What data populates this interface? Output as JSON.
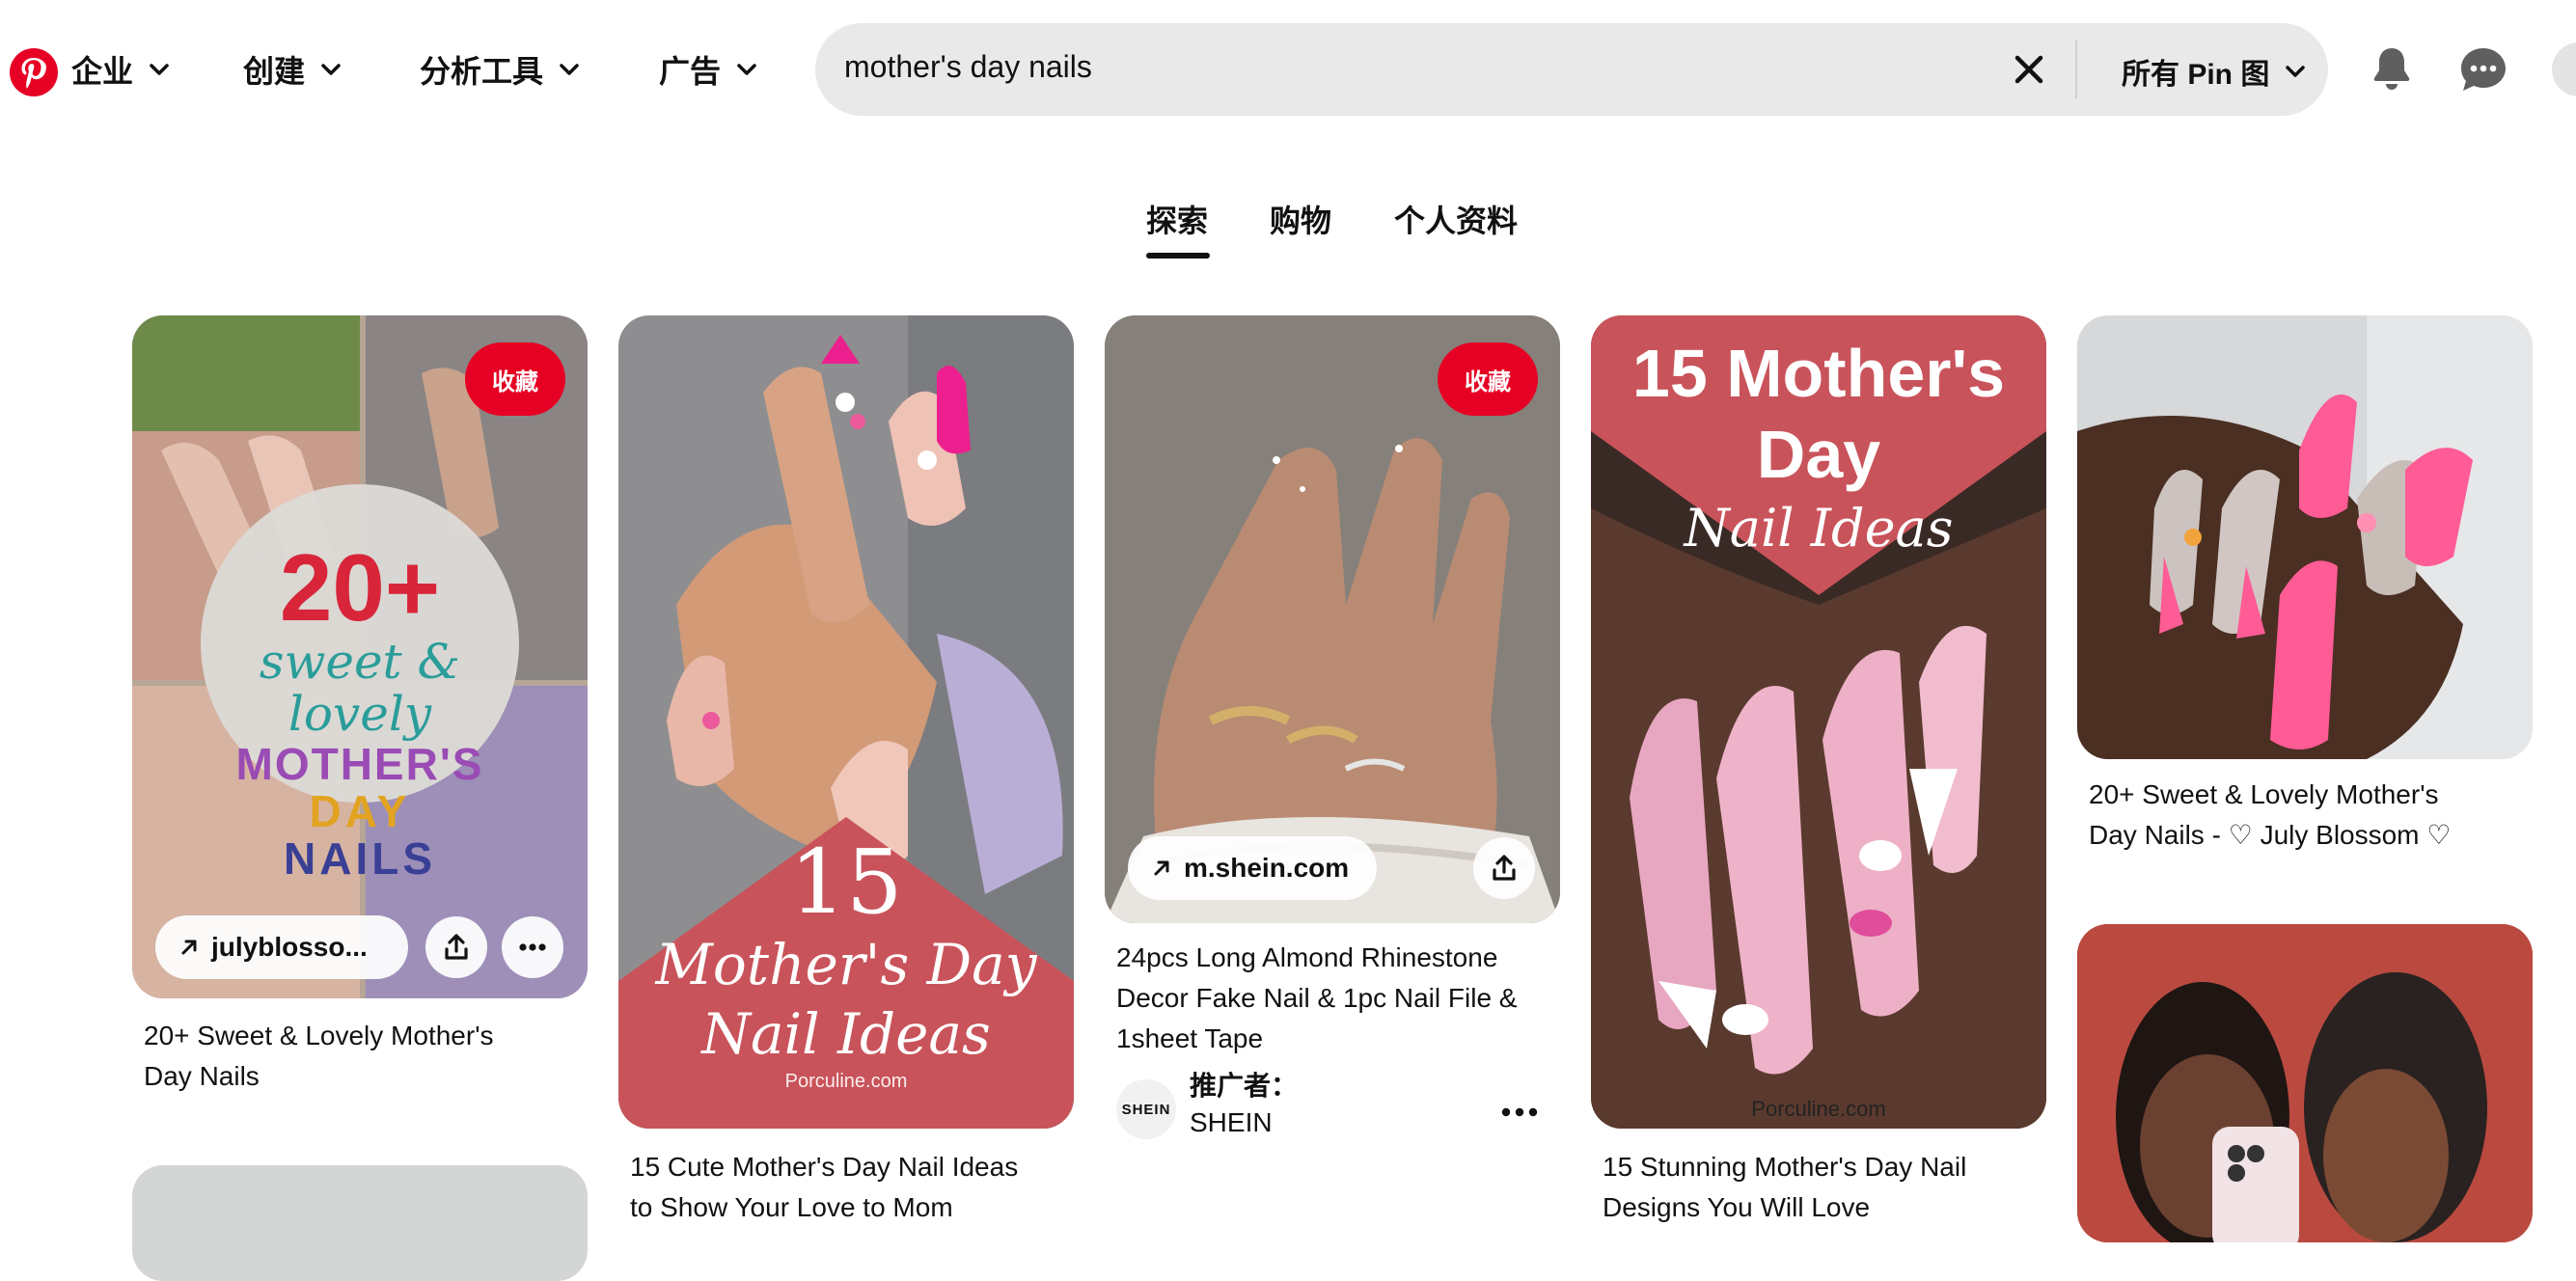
{
  "nav": {
    "items": [
      {
        "label": "企业"
      },
      {
        "label": "创建"
      },
      {
        "label": "分析工具"
      },
      {
        "label": "广告"
      }
    ]
  },
  "search": {
    "query": "mother's day nails",
    "filter_label": "所有 Pin 图"
  },
  "tabs": [
    {
      "label": "探索",
      "active": true
    },
    {
      "label": "购物",
      "active": false
    },
    {
      "label": "个人资料",
      "active": false
    }
  ],
  "pins": {
    "save_label": "收藏",
    "p1": {
      "domain": "julyblosso...",
      "title_line1": "20+ Sweet & Lovely Mother's",
      "title_line2": "Day Nails",
      "overlay": {
        "line1": "20+",
        "line2": "sweet & lovely",
        "line3": "MOTHER'S",
        "line4": "DAY",
        "line5": "NAILS"
      }
    },
    "p2": {
      "title_line1": "15 Cute Mother's Day Nail Ideas",
      "title_line2": "to Show Your Love to Mom",
      "overlay": {
        "number": "15",
        "line1": "Mother's Day",
        "line2": "Nail Ideas",
        "credit": "Porculine.com"
      }
    },
    "p3": {
      "domain": "m.shein.com",
      "title_line1": "24pcs Long Almond Rhinestone",
      "title_line2": "Decor Fake Nail & 1pc Nail File &",
      "title_line3": "1sheet Tape",
      "promoted_label": "推广者：",
      "advertiser": "SHEIN",
      "advertiser_logo_text": "SHEIN"
    },
    "p4": {
      "title_line1": "15 Stunning Mother's Day Nail",
      "title_line2": "Designs You Will Love",
      "overlay": {
        "line1": "15 Mother's Day",
        "line2": "Nail Ideas",
        "credit": "Porculine.com"
      }
    },
    "p5": {
      "title_line1": "20+ Sweet & Lovely Mother's",
      "title_line2": "Day Nails - ♡ July Blossom ♡"
    }
  },
  "colors": {
    "brand_red": "#e60023",
    "overlay_red": "#c9535a",
    "search_bg": "#e9e9e9",
    "text": "#111111"
  },
  "icons": [
    "pinterest-logo-icon",
    "chevron-down-icon",
    "close-icon",
    "bell-icon",
    "chat-icon",
    "arrow-up-right-icon",
    "share-icon",
    "more-icon"
  ]
}
